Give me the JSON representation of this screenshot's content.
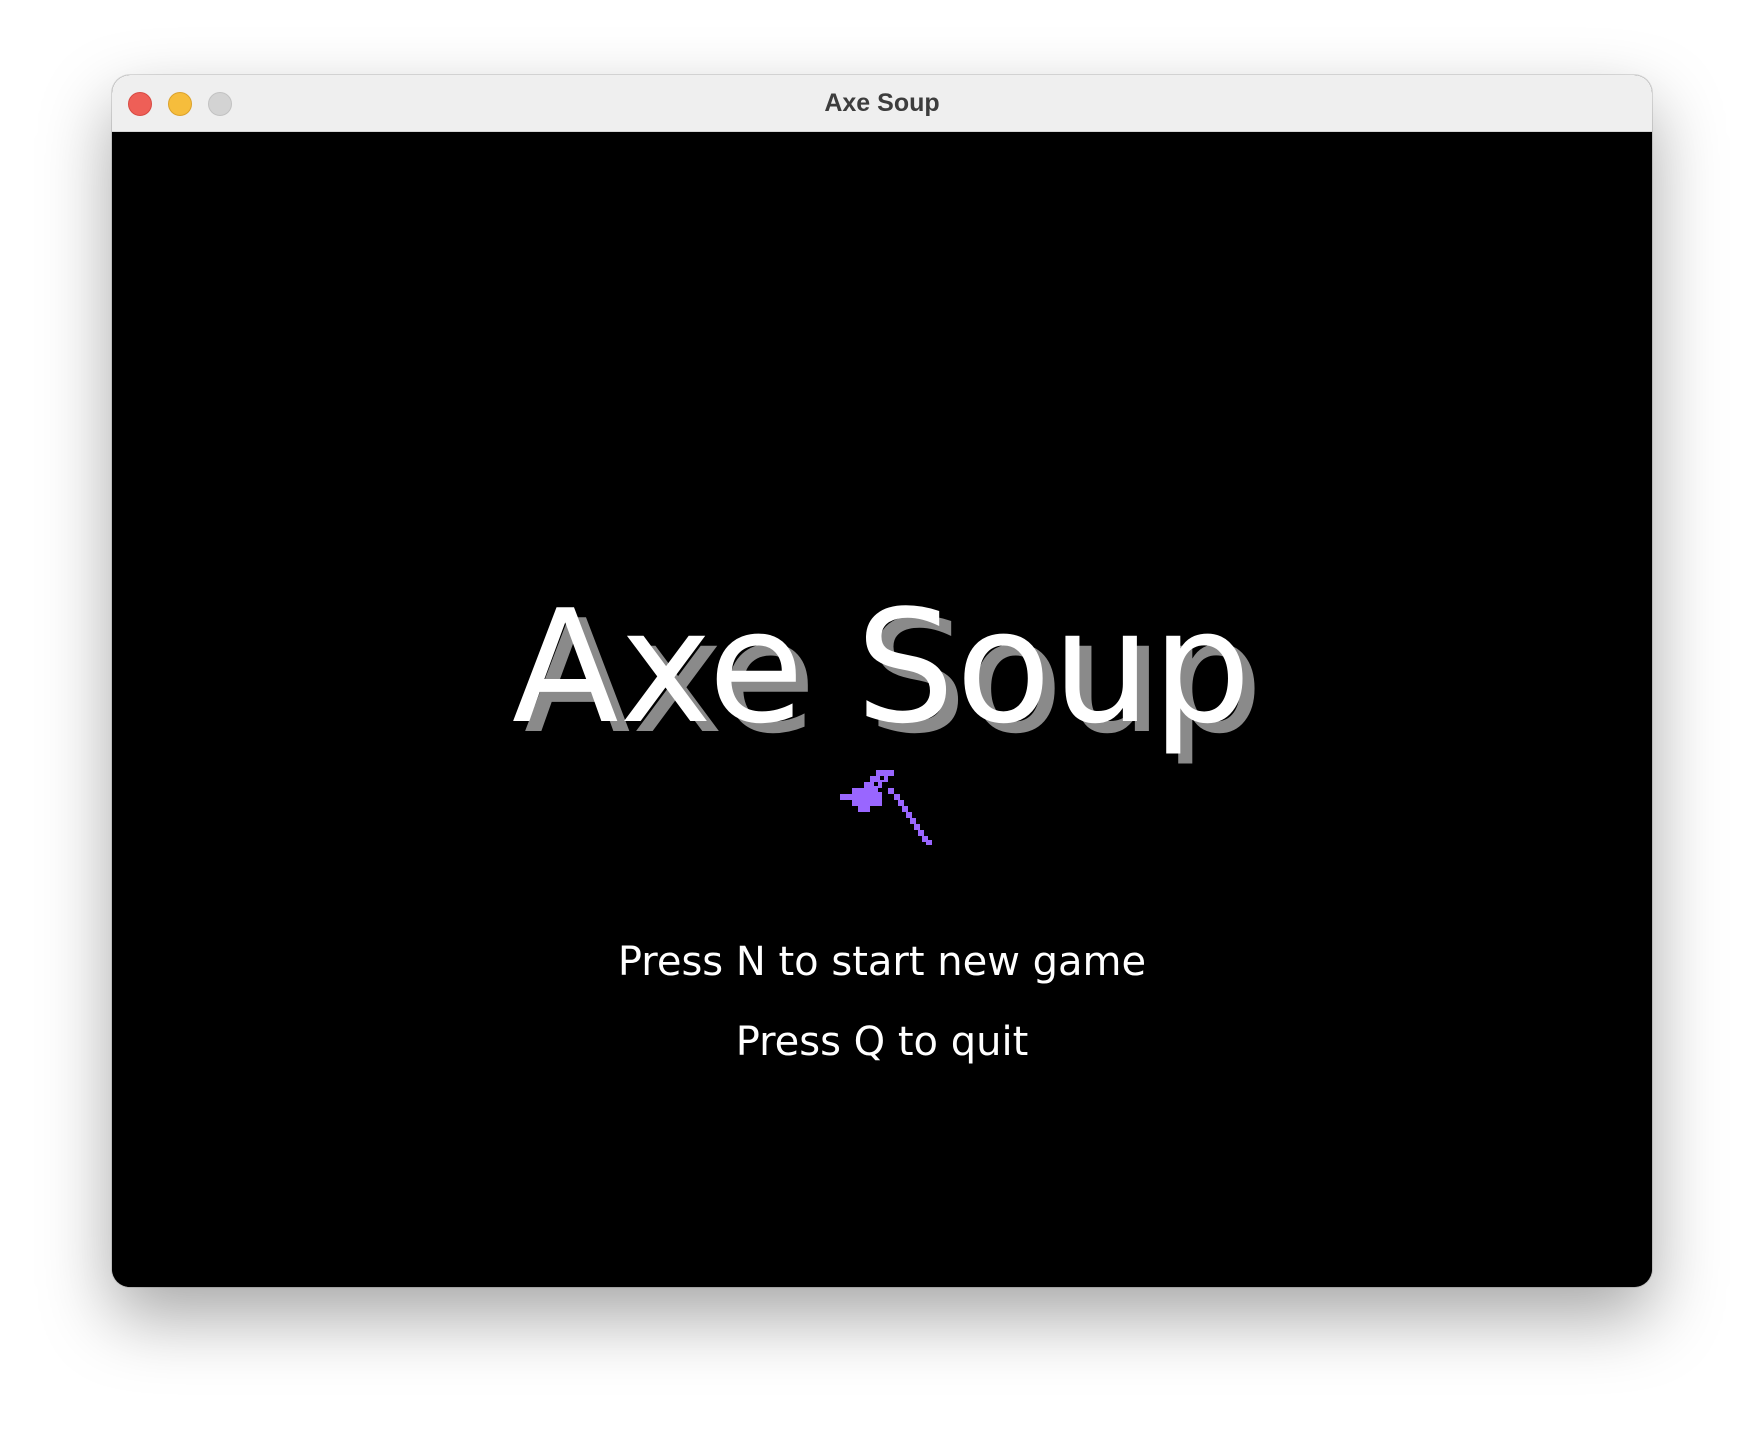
{
  "window": {
    "title": "Axe Soup"
  },
  "game": {
    "title": "Axe Soup",
    "title_color": "#ffffff",
    "title_shadow_color": "#8a8a8a",
    "logo_icon": "axe-icon",
    "logo_color": "#9966ff",
    "menu": [
      {
        "key": "N",
        "label": "Press N to start new game"
      },
      {
        "key": "Q",
        "label": "Press Q to quit"
      }
    ]
  }
}
